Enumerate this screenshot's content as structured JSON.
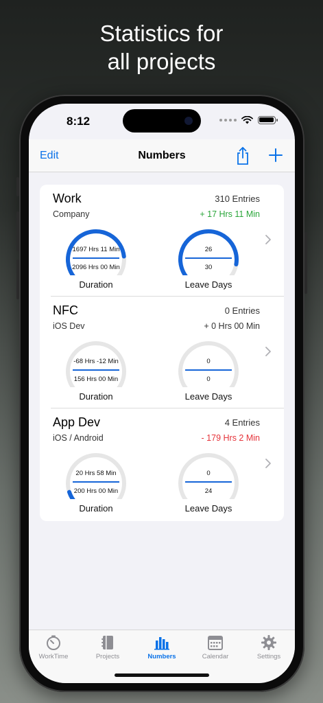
{
  "headline": [
    "Statistics for",
    "all projects"
  ],
  "status": {
    "time": "8:12"
  },
  "navbar": {
    "edit_label": "Edit",
    "title": "Numbers"
  },
  "colors": {
    "accent": "#0a72e8",
    "positive": "#2aa63a",
    "negative": "#e5333a",
    "gauge_track": "#e6e6e6",
    "gauge_fill": "#1665d8"
  },
  "projects": [
    {
      "name": "Work",
      "entries": "310 Entries",
      "subtitle": "Company",
      "delta": "+ 17 Hrs 11 Min",
      "delta_sign": "positive",
      "duration": {
        "top": "1697 Hrs 11 Min",
        "bottom": "2096 Hrs 00 Min",
        "label": "Duration",
        "progress": 0.81
      },
      "leave": {
        "top": "26",
        "bottom": "30",
        "label": "Leave Days",
        "progress": 0.87
      }
    },
    {
      "name": "NFC",
      "entries": "0 Entries",
      "subtitle": "iOS Dev",
      "delta": "+ 0 Hrs 00 Min",
      "delta_sign": "neutral",
      "duration": {
        "top": "-68 Hrs -12 Min",
        "bottom": "156 Hrs 00 Min",
        "label": "Duration",
        "progress": 0
      },
      "leave": {
        "top": "0",
        "bottom": "0",
        "label": "Leave Days",
        "progress": 0
      }
    },
    {
      "name": "App Dev",
      "entries": "4 Entries",
      "subtitle": "iOS / Android",
      "delta": "- 179 Hrs 2 Min",
      "delta_sign": "negative",
      "duration": {
        "top": "20 Hrs 58 Min",
        "bottom": "200 Hrs 00 Min",
        "label": "Duration",
        "progress": 0.1
      },
      "leave": {
        "top": "0",
        "bottom": "24",
        "label": "Leave Days",
        "progress": 0
      }
    }
  ],
  "tabs": [
    {
      "label": "WorkTime",
      "icon": "timer-icon",
      "active": false
    },
    {
      "label": "Projects",
      "icon": "binder-icon",
      "active": false
    },
    {
      "label": "Numbers",
      "icon": "bar-chart-icon",
      "active": true
    },
    {
      "label": "Calendar",
      "icon": "calendar-icon",
      "active": false
    },
    {
      "label": "Settings",
      "icon": "gear-icon",
      "active": false
    }
  ]
}
